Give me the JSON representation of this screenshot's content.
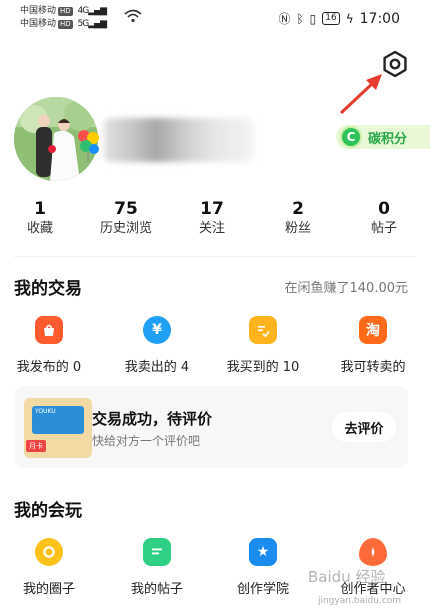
{
  "status_bar": {
    "carrier1": "中国移动",
    "carrier2": "中国移动",
    "hd": "HD",
    "net1": "4G",
    "net2": "5G",
    "battery": "16",
    "time": "17:00"
  },
  "profile": {
    "carbon_points_label": "碳积分",
    "carbon_icon_letter": "C"
  },
  "stats": [
    {
      "value": "1",
      "label": "收藏"
    },
    {
      "value": "75",
      "label": "历史浏览"
    },
    {
      "value": "17",
      "label": "关注"
    },
    {
      "value": "2",
      "label": "粉丝"
    },
    {
      "value": "0",
      "label": "帖子"
    }
  ],
  "trade": {
    "title": "我的交易",
    "earned": "在闲鱼赚了140.00元",
    "items": [
      {
        "label": "我发布的 0",
        "icon": "bag-icon",
        "color": "#ff5b2e"
      },
      {
        "label": "我卖出的 4",
        "icon": "yen-icon",
        "color": "#1fa0f5"
      },
      {
        "label": "我买到的 10",
        "icon": "purchase-check-icon",
        "color": "#ffb41e"
      },
      {
        "label": "我可转卖的",
        "icon": "taobao-icon",
        "color": "#ff6a1a"
      }
    ]
  },
  "eval_card": {
    "title": "交易成功，待评价",
    "subtitle": "快给对方一个评价吧",
    "button": "去评价",
    "thumb_tag": "月卡",
    "thumb_brand": "YOUKU"
  },
  "play": {
    "title": "我的会玩",
    "items": [
      {
        "label": "我的圈子",
        "icon": "circle-icon",
        "color": "#ffc21a"
      },
      {
        "label": "我的帖子",
        "icon": "post-icon",
        "color": "#2fcf86"
      },
      {
        "label": "创作学院",
        "icon": "star-icon",
        "color": "#1a8cf0"
      },
      {
        "label": "创作者中心",
        "icon": "creator-icon",
        "color": "#ff6a3a"
      }
    ]
  },
  "watermark": {
    "text": "Baidu 经验",
    "url": "jingyan.baidu.com"
  }
}
